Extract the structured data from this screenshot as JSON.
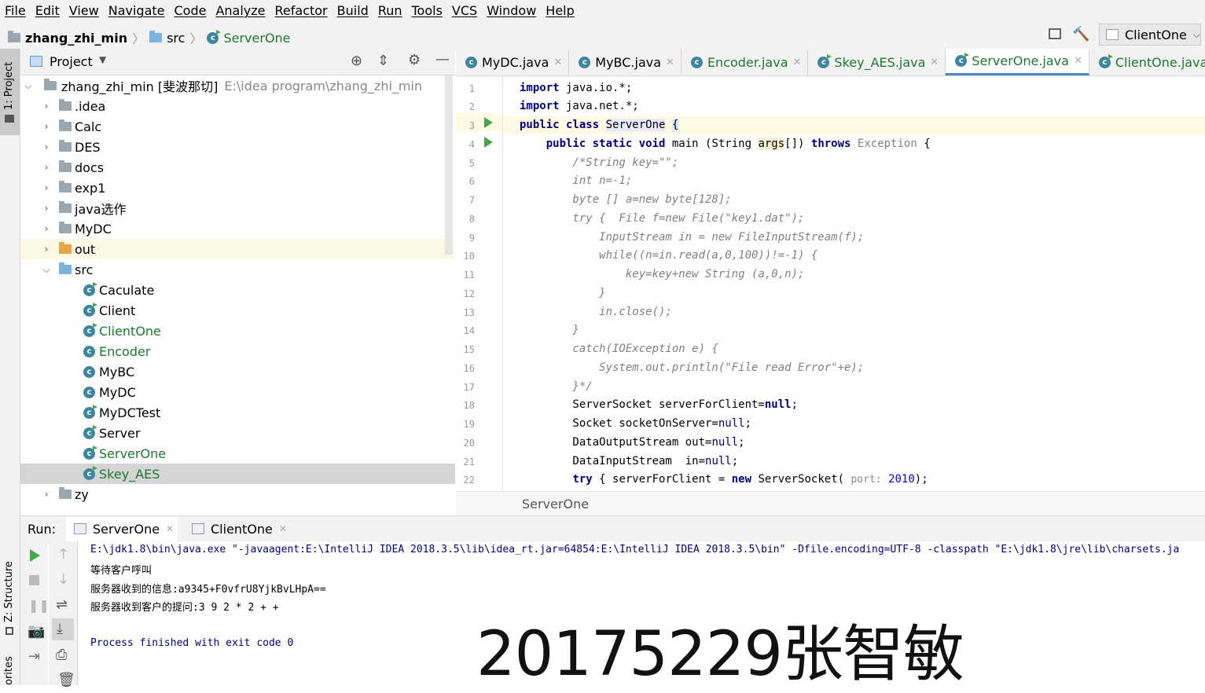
{
  "menu": [
    "File",
    "Edit",
    "View",
    "Navigate",
    "Code",
    "Analyze",
    "Refactor",
    "Build",
    "Run",
    "Tools",
    "VCS",
    "Window",
    "Help"
  ],
  "nav": {
    "project": "zhang_zhi_min",
    "src": "src",
    "file": "ServerOne",
    "run_config": "ClientOne"
  },
  "left_stripe": {
    "project_tab": "1: Project",
    "structure_tab": "Z: Structure",
    "favorites_tab": "orites"
  },
  "project_panel": {
    "title": "Project",
    "root_name": "zhang_zhi_min [斐波那切]",
    "root_path": "E:\\idea program\\zhang_zhi_min",
    "folders": [
      ".idea",
      "Calc",
      "DES",
      "docs",
      "exp1",
      "java选作",
      "MyDC",
      "out",
      "src"
    ],
    "src_files": [
      "Caculate",
      "Client",
      "ClientOne",
      "Encoder",
      "MyBC",
      "MyDC",
      "MyDCTest",
      "Server",
      "ServerOne",
      "Skey_AES"
    ],
    "after": [
      "zy"
    ]
  },
  "editor": {
    "tabs": [
      "MyDC.java",
      "MyBC.java",
      "Encoder.java",
      "Skey_AES.java",
      "ServerOne.java",
      "ClientOne.java"
    ],
    "active_tab": "ServerOne.java",
    "line_numbers": [
      "1",
      "2",
      "3",
      "4",
      "5",
      "6",
      "7",
      "8",
      "9",
      "10",
      "11",
      "12",
      "13",
      "14",
      "15",
      "16",
      "17",
      "18",
      "19",
      "20",
      "21",
      "22"
    ],
    "breadcrumb": "ServerOne"
  },
  "run": {
    "label": "Run:",
    "tabs": [
      "ServerOne",
      "ClientOne"
    ],
    "output": [
      "E:\\jdk1.8\\bin\\java.exe \"-javaagent:E:\\IntelliJ IDEA 2018.3.5\\lib\\idea_rt.jar=64854:E:\\IntelliJ IDEA 2018.3.5\\bin\" -Dfile.encoding=UTF-8 -classpath \"E:\\jdk1.8\\jre\\lib\\charsets.ja",
      "等待客户呼叫",
      "服务器收到的信息:a9345+F0vfrU8YjkBvLHpA==",
      "服务器收到客户的提问:3 9 2 * 2 + +",
      "",
      "Process finished with exit code 0"
    ]
  },
  "watermark": "20175229张智敏"
}
